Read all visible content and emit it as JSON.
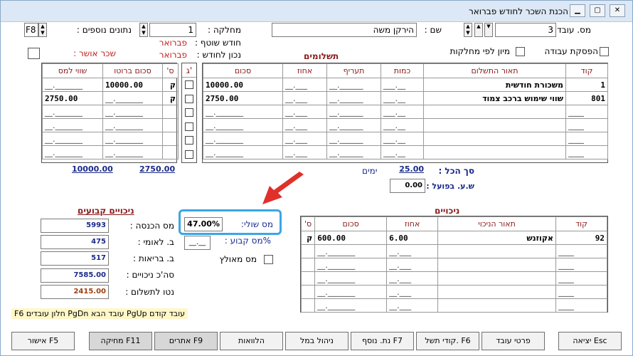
{
  "window": {
    "title": "הכנת השכר לחודש פברואר",
    "min": "▁",
    "max": "▢",
    "close": "✕"
  },
  "header": {
    "employee_no_label": "מס. עובד :",
    "employee_no_value": "3",
    "name_label": "שם :",
    "name_value": "הירקן משה",
    "department_label": "מחלקה :",
    "department_value": "1",
    "extra_data_label": "נתונים נוספים :",
    "extra_data_value": "F8",
    "current_month_label": "חודש שוטף :",
    "current_month_value": "פברואר",
    "valid_for_label": "נכון לחודש :",
    "valid_for_value": "פברואר",
    "approved_pay_label": "שכר אושר :",
    "stop_work_label": "הפסקת עבודה",
    "sort_by_dept_label": "מיון לפי מחלקות"
  },
  "payments": {
    "title": "תשלומים",
    "columns": [
      "קוד",
      "תאור התשלום",
      "כמות",
      "תעריף",
      "אחוז",
      "סכום"
    ],
    "rows": [
      {
        "code": "1",
        "desc": "משכורת חודשית",
        "qty": "__.___",
        "rate": "______.__",
        "pct": "___.__",
        "amount": "10000.00"
      },
      {
        "code": "801",
        "desc": "שווי שימוש ברכב צמוד",
        "qty": "__.___",
        "rate": "______.__",
        "pct": "___.__",
        "amount": "2750.00"
      },
      {
        "code": "____",
        "desc": "",
        "qty": "__.___",
        "rate": "______.__",
        "pct": "___.__",
        "amount": "_______.__"
      },
      {
        "code": "____",
        "desc": "",
        "qty": "__.___",
        "rate": "______.__",
        "pct": "___.__",
        "amount": "_______.__"
      },
      {
        "code": "____",
        "desc": "",
        "qty": "__.___",
        "rate": "______.__",
        "pct": "___.__",
        "amount": "_______.__"
      },
      {
        "code": "____",
        "desc": "",
        "qty": "__.___",
        "rate": "______.__",
        "pct": "___.__",
        "amount": "_______.__"
      }
    ],
    "g_label": "ג'",
    "side_columns": [
      "ס'",
      "סכום ברוטו",
      "שווי למס"
    ],
    "side_rows": [
      {
        "s": "ק",
        "gross": "10000.00",
        "tax": "_______.__"
      },
      {
        "s": "ק",
        "gross": "_______.__",
        "tax": "2750.00"
      },
      {
        "s": "",
        "gross": "_______.__",
        "tax": "_______.__"
      },
      {
        "s": "",
        "gross": "_______.__",
        "tax": "_______.__"
      },
      {
        "s": "",
        "gross": "_______.__",
        "tax": "_______.__"
      },
      {
        "s": "",
        "gross": "_______.__",
        "tax": "_______.__"
      }
    ],
    "total_gross": "10000.00",
    "total_tax": "2750.00",
    "total_label": "סך הכל :",
    "days_value": "25.00",
    "days_label": "ימים",
    "actual_hours_label": "ש.ע. בפועל :",
    "actual_hours_value": "0.00"
  },
  "fixed_deductions": {
    "title": "ניכויים קבועים",
    "income_tax_label": "מס הכנסה :",
    "income_tax_value": "5993",
    "national_ins_label": "ב. לאומי :",
    "national_ins_value": "475",
    "health_ins_label": "ב. בריאות :",
    "health_ins_value": "517",
    "total_deductions_label": "סה'כ ניכויים :",
    "total_deductions_value": "7585.00",
    "net_pay_label": "נטו לתשלום :",
    "net_pay_value": "2415.00",
    "marginal_tax_label": "מס שולי:",
    "marginal_tax_value": "47.00%",
    "fixed_tax_label": "%מס קבוע :",
    "fixed_tax_value": "__.__",
    "forced_tax_label": "מס מאולץ"
  },
  "deductions": {
    "title": "ניכויים",
    "columns": [
      "קוד",
      "תאור הניכוי",
      "אחוז",
      "סכום",
      "ס'"
    ],
    "rows": [
      {
        "code": "92",
        "desc": "אקוזנש",
        "pct": "6.00",
        "amount": "600.00",
        "s": "ק"
      },
      {
        "code": "____",
        "desc": "",
        "pct": "___.__",
        "amount": "_______.__",
        "s": ""
      },
      {
        "code": "____",
        "desc": "",
        "pct": "___.__",
        "amount": "_______.__",
        "s": ""
      },
      {
        "code": "____",
        "desc": "",
        "pct": "___.__",
        "amount": "_______.__",
        "s": ""
      },
      {
        "code": "____",
        "desc": "",
        "pct": "___.__",
        "amount": "_______.__",
        "s": ""
      },
      {
        "code": "____",
        "desc": "",
        "pct": "___.__",
        "amount": "_______.__",
        "s": ""
      }
    ]
  },
  "hint": "F6 חלון עובדים  PgDn עובד הבא  PgUp עובד קודם",
  "buttons": {
    "exit": "יציאה Esc",
    "employee_details": "פרטי עובד",
    "payment_codes": "קודי תשל. F6",
    "additional_data": "נת. נוסף F7",
    "manage": "ניהול במל",
    "loans": "הלוואות",
    "search": "אתרים F9",
    "delete": "מחיקה F11",
    "approve": "אישור F5"
  },
  "colors": {
    "accent": "#3ba6e6",
    "arrow": "#e0302a",
    "header_text": "#8a1a1a",
    "total_text": "#1a2a8a",
    "net_pay": "#a04010"
  }
}
